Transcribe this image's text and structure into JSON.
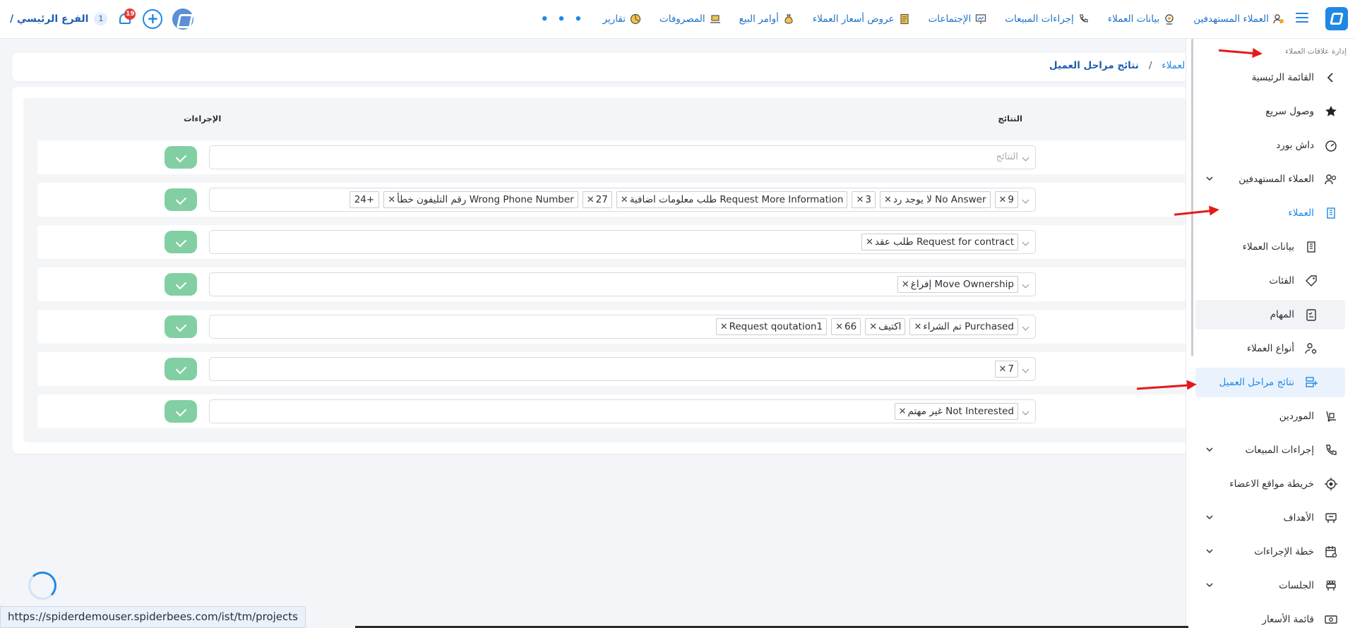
{
  "topbar": {
    "nav_items": [
      {
        "label": "العملاء المستهدفين",
        "icon": "users-target-icon"
      },
      {
        "label": "بيانات العملاء",
        "icon": "webcam-icon"
      },
      {
        "label": "إجراءات المبيعات",
        "icon": "phone-icon"
      },
      {
        "label": "الإجتماعات",
        "icon": "presentation-icon"
      },
      {
        "label": "عروض أسعار العملاء",
        "icon": "quote-document-icon"
      },
      {
        "label": "أوامر البيع",
        "icon": "money-bag-icon"
      },
      {
        "label": "المصروفات",
        "icon": "laptop-icon"
      },
      {
        "label": "تقارير",
        "icon": "report-chart-icon"
      }
    ],
    "more": "• • •",
    "branch": {
      "label": "الفرع الرئيسي /",
      "count": "1"
    },
    "notifications": "19",
    "add": "+"
  },
  "breadcrumb": {
    "parent": "العملاء",
    "separator": "/",
    "current": "نتائج مراحل العميل"
  },
  "table": {
    "headers": {
      "results": "النتائج",
      "actions": "الإجراءات"
    },
    "placeholder": "النتائج",
    "rows": [
      {
        "tags": []
      },
      {
        "tags": [
          "9",
          "No Answer لا يوجد رد",
          "3",
          "Request More Information طلب معلومات اضافية",
          "27",
          "Wrong Phone Number رقم التليفون خطأ"
        ],
        "more": "+24"
      },
      {
        "tags": [
          "Request for contract طلب عقد"
        ]
      },
      {
        "tags": [
          "Move Ownership إفراغ"
        ]
      },
      {
        "tags": [
          "Purchased تم الشراء",
          "اكتيف",
          "66",
          "Request qoutation1"
        ]
      },
      {
        "tags": [
          "7"
        ]
      },
      {
        "tags": [
          "Not Interested غير مهتم"
        ]
      }
    ]
  },
  "sidebar": {
    "section": "إدارة علاقات العملاء",
    "items": [
      {
        "label": "القائمة الرئيسية",
        "icon": "chevron-left-icon"
      },
      {
        "label": "وصول سريع",
        "icon": "star-icon"
      },
      {
        "label": "داش بورد",
        "icon": "speedometer-icon"
      },
      {
        "label": "العملاء المستهدفين",
        "icon": "users-icon"
      },
      {
        "label": "العملاء",
        "icon": "building-icon"
      },
      {
        "label": "بيانات العملاء",
        "icon": "building-icon"
      },
      {
        "label": "الفئات",
        "icon": "tag-icon"
      },
      {
        "label": "المهام",
        "icon": "clipboard-icon"
      },
      {
        "label": "أنواع العملاء",
        "icon": "user-settings-icon"
      },
      {
        "label": "نتائج مراحل العميل",
        "icon": "list-add-icon"
      },
      {
        "label": "الموردين",
        "icon": "hand-truck-icon"
      },
      {
        "label": "إجراءات المبيعات",
        "icon": "phone-call-icon"
      },
      {
        "label": "خريطة مواقع الاعضاء",
        "icon": "location-icon"
      },
      {
        "label": "الأهداف",
        "icon": "target-icon"
      },
      {
        "label": "خطة الإجراءات",
        "icon": "calendar-icon"
      },
      {
        "label": "الجلسات",
        "icon": "meeting-icon"
      },
      {
        "label": "قائمة الأسعار",
        "icon": "price-list-icon"
      }
    ]
  },
  "status_url": "https://spiderdemouser.spiderbees.com/ist/tm/projects",
  "colors": {
    "accent": "#1e88e5",
    "success": "#82cfa3",
    "badge": "#e53935",
    "arrow": "#e31b1b"
  }
}
